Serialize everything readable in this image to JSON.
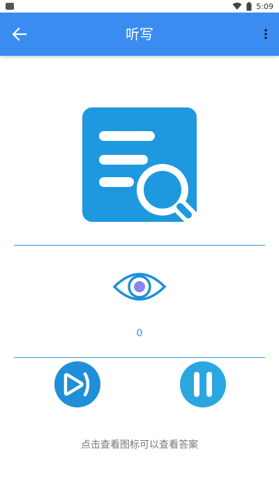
{
  "status_bar": {
    "time": "5:09",
    "icons": [
      "notification-icon",
      "wifi-icon",
      "battery-icon"
    ]
  },
  "app_bar": {
    "title": "听写",
    "back_icon": "arrow-left-icon",
    "menu_icon": "more-vert-icon",
    "background_color": "#3b8cf0"
  },
  "main": {
    "illustration_icon": "document-search-icon",
    "eye_icon": "eye-icon",
    "view_count": "0",
    "play_next_icon": "play-next-icon",
    "pause_icon": "pause-icon",
    "hint": "点击查看图标可以查看答案"
  },
  "colors": {
    "accent": "#1e8fd8",
    "eye_pupil": "#8a86ee",
    "hint_text": "#777777"
  }
}
